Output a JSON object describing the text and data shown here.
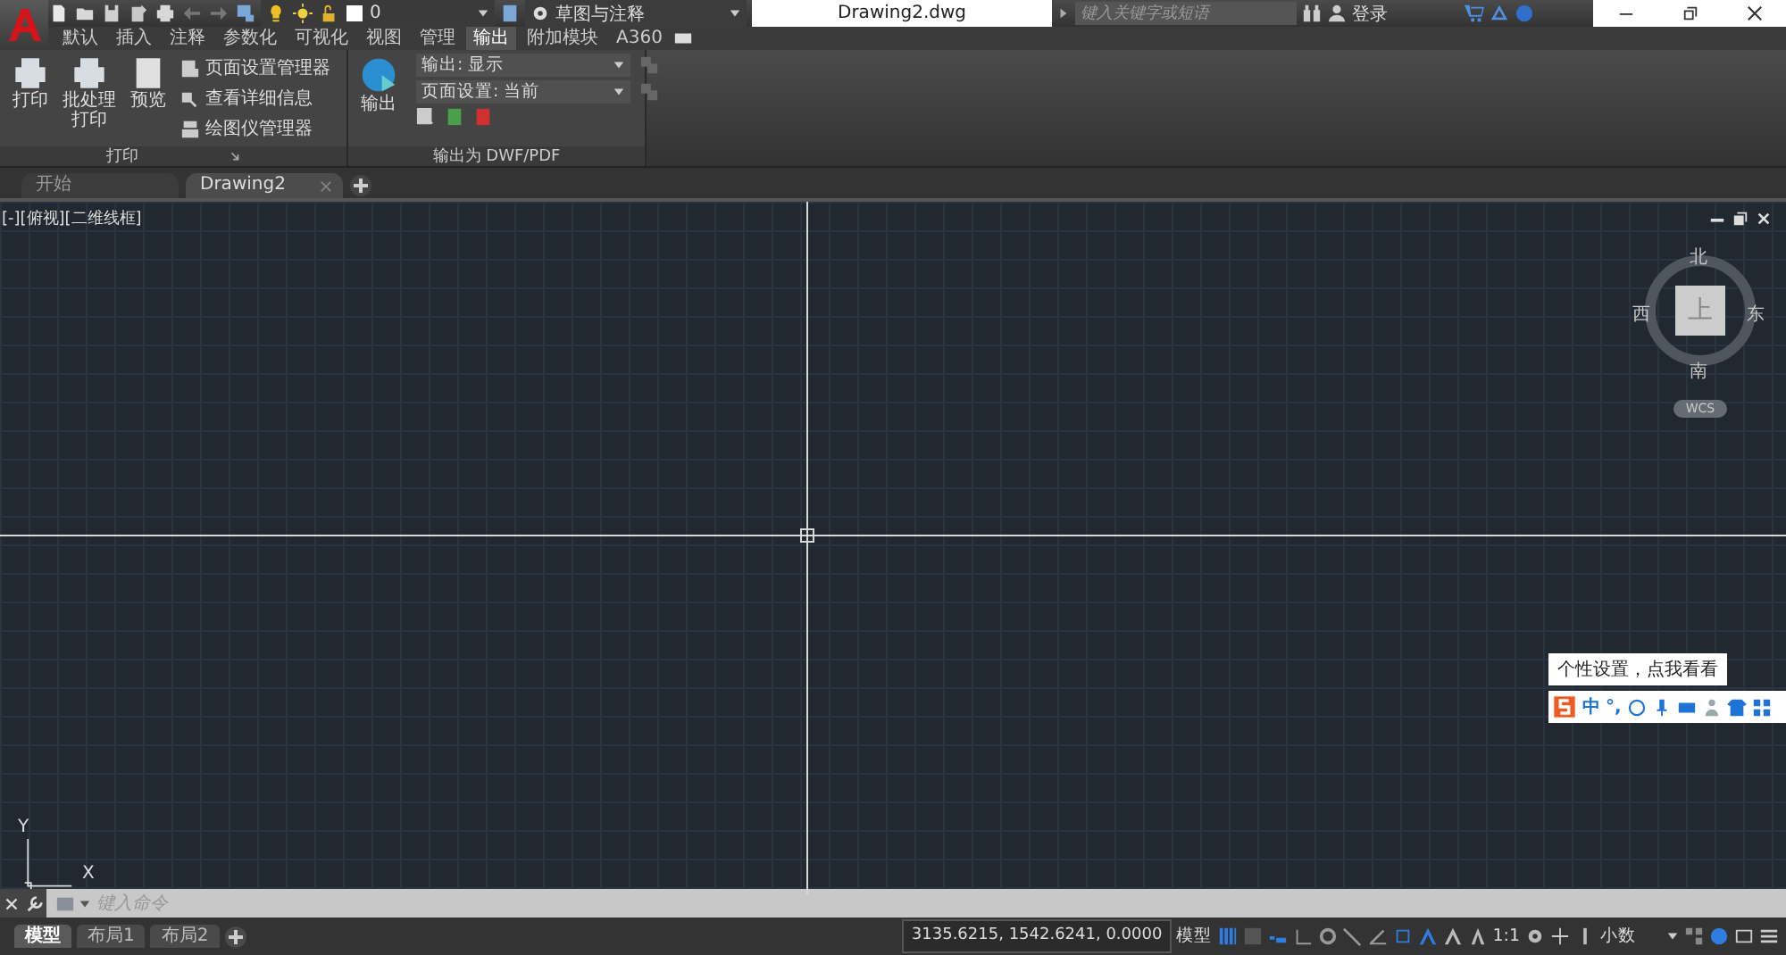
{
  "title_bar": {
    "layer": "0",
    "workspace": "草图与注释",
    "file_title": "Drawing2.dwg",
    "search": {
      "placeholder": "键入关键字或短语"
    },
    "login": "登录"
  },
  "ribbon_tabs": [
    {
      "label": "默认",
      "selected": false
    },
    {
      "label": "插入",
      "selected": false
    },
    {
      "label": "注释",
      "selected": false
    },
    {
      "label": "参数化",
      "selected": false
    },
    {
      "label": "可视化",
      "selected": false
    },
    {
      "label": "视图",
      "selected": false
    },
    {
      "label": "管理",
      "selected": false
    },
    {
      "label": "输出",
      "selected": true
    },
    {
      "label": "附加模块",
      "selected": false
    },
    {
      "label": "A360",
      "selected": false
    }
  ],
  "print_panel": {
    "title": "打印",
    "large_buttons": [
      "打印",
      "批处理打印",
      "预览"
    ],
    "small_buttons": [
      "页面设置管理器",
      "查看详细信息",
      "绘图仪管理器"
    ]
  },
  "export_panel": {
    "title": "输出为 DWF/PDF",
    "button": "输出",
    "dropdowns": [
      "输出: 显示",
      "页面设置: 当前"
    ]
  },
  "doc_tabs": [
    {
      "label": "开始",
      "selected": false
    },
    {
      "label": "Drawing2",
      "selected": true
    }
  ],
  "viewport_label": "[-][俯视][二维线框]",
  "viewcube": {
    "north": "北",
    "south": "南",
    "east": "东",
    "west": "西",
    "face": "上",
    "wcs": "WCS"
  },
  "ucs": {
    "y": "Y",
    "x": "X"
  },
  "ime": {
    "tooltip": "个性设置，点我看看",
    "mode": "中",
    "punctuation": "°,"
  },
  "command_line": {
    "placeholder": "键入命令"
  },
  "layout_tabs": [
    {
      "label": "模型",
      "selected": true
    },
    {
      "label": "布局1",
      "selected": false
    },
    {
      "label": "布局2",
      "selected": false
    }
  ],
  "status_bar": {
    "coordinates": "3135.6215, 1542.6241, 0.0000",
    "space": "模型",
    "scale": "1:1",
    "units": "小数"
  }
}
